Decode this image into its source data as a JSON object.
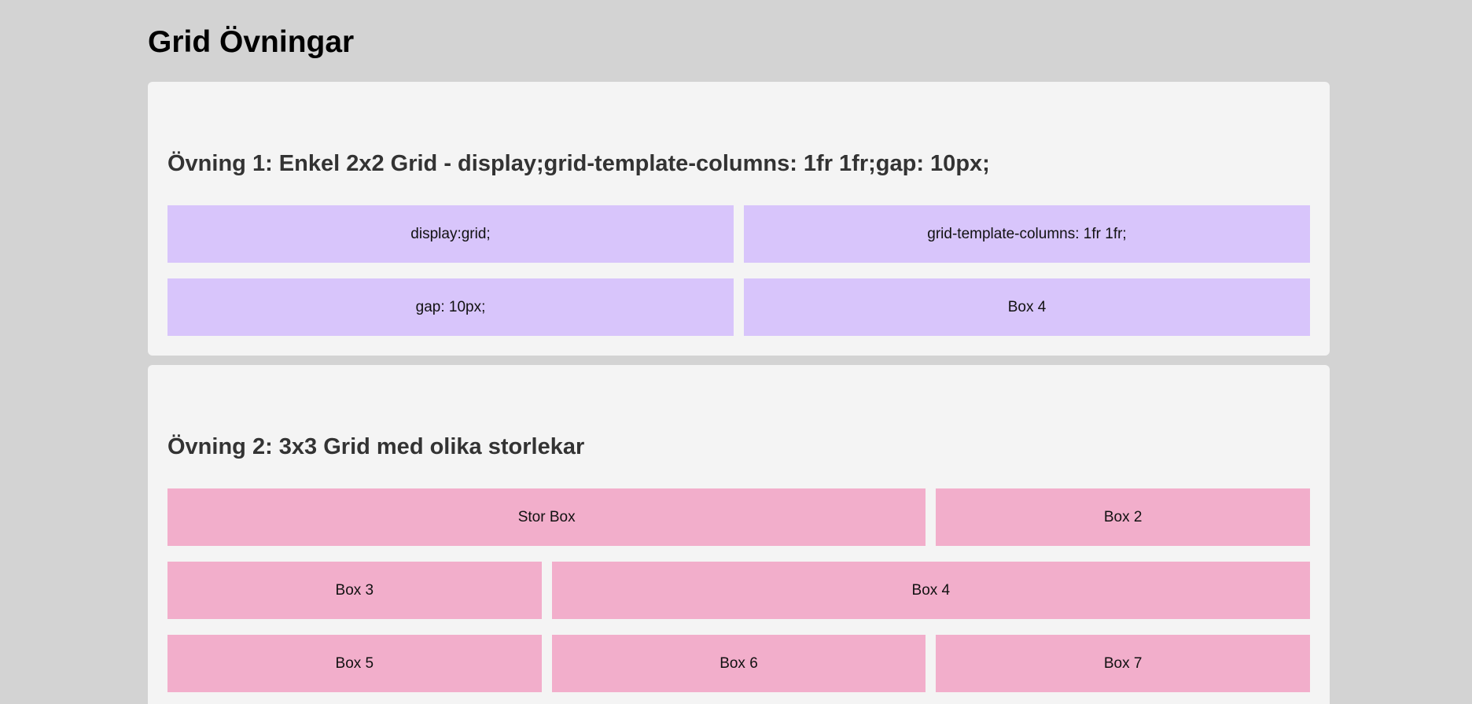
{
  "page": {
    "title": "Grid Övningar"
  },
  "exercise1": {
    "heading": "Övning 1: Enkel 2x2 Grid - display;grid-template-columns: 1fr 1fr;gap: 10px;",
    "boxes": [
      "display:grid;",
      "grid-template-columns: 1fr 1fr;",
      "gap: 10px;",
      "Box 4"
    ],
    "box_color": "#d8c5fb"
  },
  "exercise2": {
    "heading": "Övning 2: 3x3 Grid med olika storlekar",
    "boxes": [
      "Stor Box",
      "Box 2",
      "Box 3",
      "Box 4",
      "Box 5",
      "Box 6",
      "Box 7"
    ],
    "box_color": "#f2aecb"
  },
  "colors": {
    "page_background": "#d3d3d3",
    "card_background": "#f4f4f4"
  }
}
